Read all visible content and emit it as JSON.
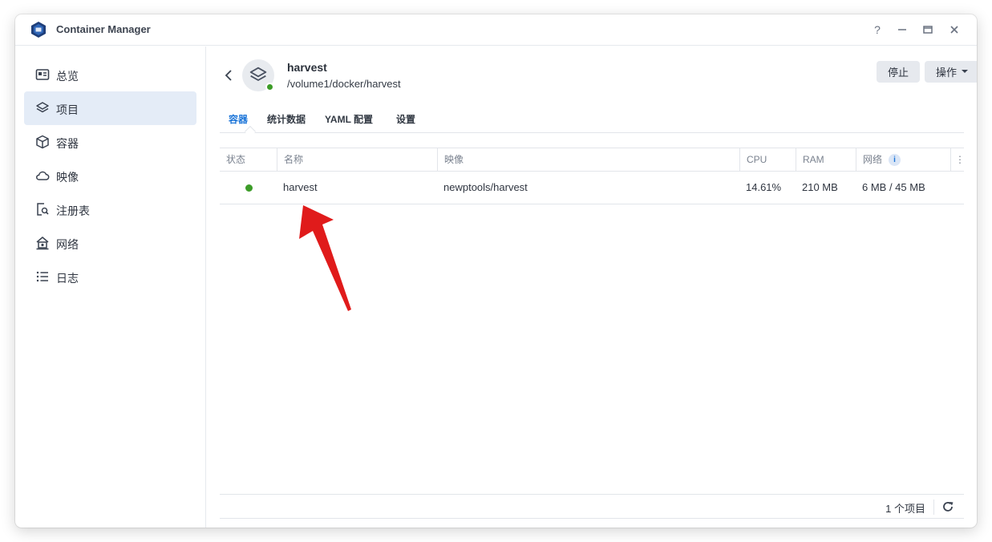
{
  "window": {
    "title": "Container Manager",
    "controls": {
      "help": "?",
      "minimize": "—",
      "maximize": "▭",
      "close": "✕"
    }
  },
  "sidebar": {
    "items": [
      {
        "label": "总览",
        "icon": "overview-icon"
      },
      {
        "label": "项目",
        "icon": "layers-icon",
        "active": true
      },
      {
        "label": "容器",
        "icon": "cube-icon"
      },
      {
        "label": "映像",
        "icon": "cloud-icon"
      },
      {
        "label": "注册表",
        "icon": "registry-search-icon"
      },
      {
        "label": "网络",
        "icon": "network-house-icon"
      },
      {
        "label": "日志",
        "icon": "list-icon"
      }
    ]
  },
  "project": {
    "name": "harvest",
    "path": "/volume1/docker/harvest",
    "status_color": "#3c9c28"
  },
  "actions": {
    "stop_label": "停止",
    "operate_label": "操作"
  },
  "tabs": [
    {
      "label": "容器",
      "active": true
    },
    {
      "label": "统计数据"
    },
    {
      "label": "YAML 配置"
    },
    {
      "label": "设置"
    }
  ],
  "table": {
    "headers": {
      "status": "状态",
      "name": "名称",
      "image": "映像",
      "cpu": "CPU",
      "ram": "RAM",
      "network": "网络",
      "network_info": "i",
      "more": "⋮"
    },
    "rows": [
      {
        "status": "running",
        "name": "harvest",
        "image": "newptools/harvest",
        "cpu": "14.61%",
        "ram": "210 MB",
        "network": "6 MB / 45 MB"
      }
    ]
  },
  "footer": {
    "count_label": "1 个项目"
  },
  "colors": {
    "accent": "#1a74d8",
    "running": "#3c9c28",
    "annotation_arrow": "#e01b1b"
  }
}
